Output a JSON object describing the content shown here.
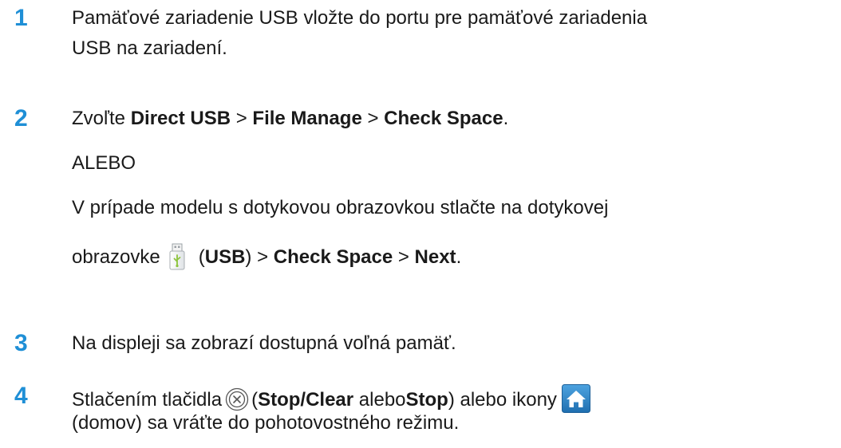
{
  "steps": [
    {
      "number": "1",
      "lines": [
        "Pamäťové zariadenie USB vložte do portu pre pamäťové zariadenia",
        "USB na zariadení."
      ]
    },
    {
      "number": "2",
      "line1": {
        "prefix": "Zvoľte ",
        "b1": "Direct USB",
        "sep1": " > ",
        "b2": "File Manage",
        "sep2": " > ",
        "b3": "Check Space",
        "end": "."
      },
      "alt": "ALEBO",
      "line3": "V prípade modelu s dotykovou obrazovkou stlačte na dotykovej",
      "line4": {
        "prefix": "obrazovke",
        "open": "(",
        "b1": "USB",
        "close": ") > ",
        "b2": "Check Space",
        "sep": " > ",
        "b3": "Next",
        "end": "."
      }
    },
    {
      "number": "3",
      "text": "Na displeji sa zobrazí dostupná voľná pamäť."
    },
    {
      "number": "4",
      "line1": {
        "prefix": "Stlačením tlačidla",
        "open": "(",
        "b1": "Stop/Clear",
        "mid": " alebo",
        "b2": "Stop",
        "suffix": ") alebo ikony"
      },
      "line2": "(domov) sa vráťte do pohotovostného režimu."
    }
  ],
  "icons": {
    "usb": "usb-icon",
    "stop": "stop-clear-icon",
    "home": "home-icon"
  },
  "colors": {
    "step_number": "#1f8fd6",
    "home_icon_bg": "#2b7fc0"
  }
}
